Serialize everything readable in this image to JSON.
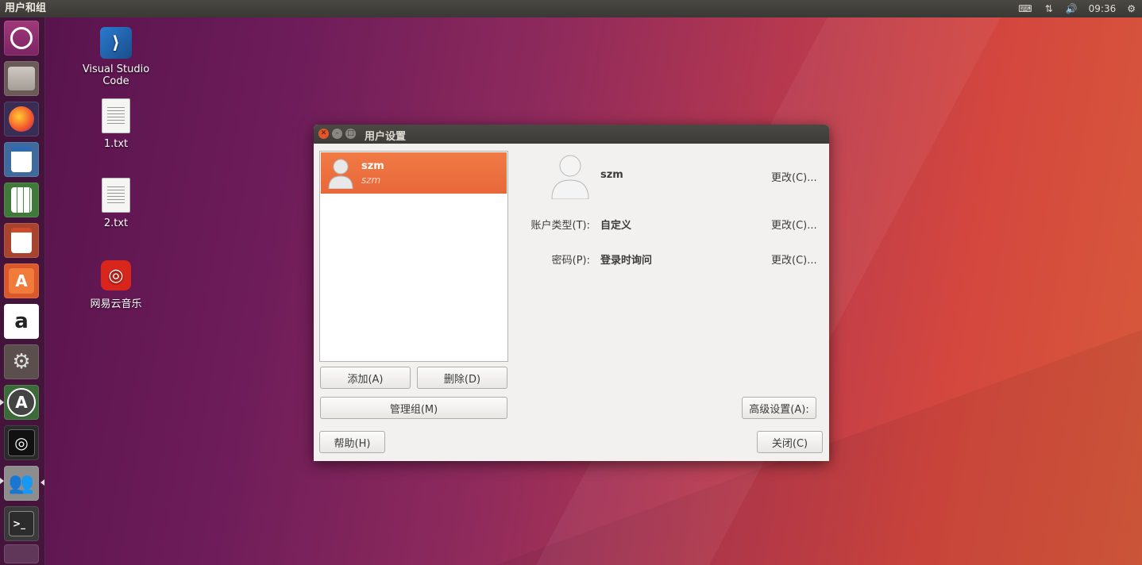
{
  "topbar": {
    "app_title": "用户和组",
    "clock": "09:36",
    "tray_icons": [
      "keyboard-icon",
      "network-icon",
      "volume-icon",
      "gear-icon"
    ]
  },
  "launcher": {
    "items": [
      "ubuntu-dash-icon",
      "files-icon",
      "firefox-icon",
      "writer-icon",
      "calc-icon",
      "impress-icon",
      "software-center-icon",
      "amazon-icon",
      "system-settings-icon",
      "software-updater-icon",
      "disk-icon",
      "users-icon",
      "terminal-icon",
      "trash-icon"
    ]
  },
  "desktop": {
    "icons": [
      {
        "label": "Visual Studio Code",
        "icon": "vscode-icon"
      },
      {
        "label": "1.txt",
        "icon": "text-file-icon"
      },
      {
        "label": "2.txt",
        "icon": "text-file-icon"
      },
      {
        "label": "网易云音乐",
        "icon": "netease-music-icon"
      }
    ]
  },
  "dialog": {
    "title": "用户设置",
    "user_list": [
      {
        "name": "szm",
        "subtitle": "szm",
        "selected": true
      }
    ],
    "buttons": {
      "add": "添加(A)",
      "delete": "删除(D)",
      "manage_groups": "管理组(M)",
      "help": "帮助(H)",
      "advanced": "高级设置(A):",
      "close": "关闭(C)"
    },
    "details": {
      "username": "szm",
      "change_label": "更改(C)...",
      "account_type_label": "账户类型(T):",
      "account_type_value": "自定义",
      "password_label": "密码(P):",
      "password_value": "登录时询问"
    }
  },
  "colors": {
    "selection": "#e8683a",
    "titlebar": "#3c3b37"
  }
}
